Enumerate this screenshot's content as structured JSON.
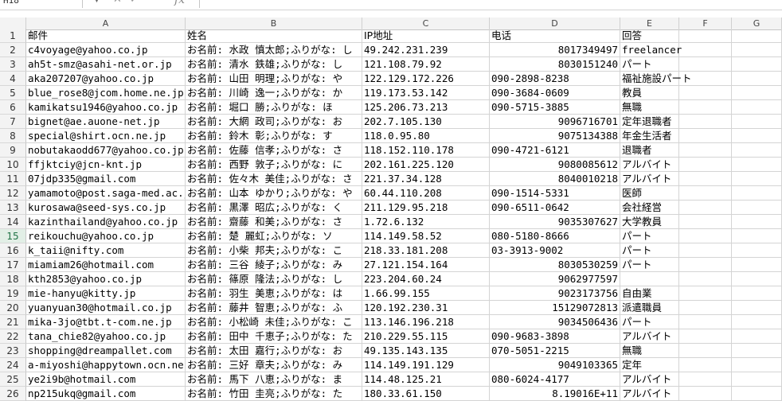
{
  "formula_bar": {
    "name_box": "H18",
    "fx_label": "fx"
  },
  "columns": [
    "A",
    "B",
    "C",
    "D",
    "E",
    "F",
    "G"
  ],
  "rows": [
    {
      "n": "1",
      "a": "邮件",
      "b": "姓名",
      "c": "IP地址",
      "d": "电话",
      "dr": false,
      "e": "回答"
    },
    {
      "n": "2",
      "a": "c4voyage@yahoo.co.jp",
      "b": "お名前: 水政 慎太郎;ふりがな: し",
      "c": "49.242.231.239",
      "d": "8017349497",
      "dr": true,
      "e": "freelancer"
    },
    {
      "n": "3",
      "a": "ah5t-smz@asahi-net.or.jp",
      "b": "お名前: 清水 鉄雄;ふりがな: し",
      "c": "121.108.79.92",
      "d": "8030151240",
      "dr": true,
      "e": "パート"
    },
    {
      "n": "4",
      "a": "aka207207@yahoo.co.jp",
      "b": "お名前: 山田 明理;ふりがな: や",
      "c": "122.129.172.226",
      "d": "090-2898-8238",
      "dr": false,
      "e": "福祉施設パート"
    },
    {
      "n": "5",
      "a": "blue_rose8@jcom.home.ne.jp",
      "b": "お名前: 川崎 逸一;ふりがな: か",
      "c": "119.173.53.142",
      "d": "090-3684-0609",
      "dr": false,
      "e": "教員"
    },
    {
      "n": "6",
      "a": "kamikatsu1946@yahoo.co.jp",
      "b": "お名前: 堀口 勝;ふりがな: ほ",
      "c": "125.206.73.213",
      "d": "090-5715-3885",
      "dr": false,
      "e": "無職"
    },
    {
      "n": "7",
      "a": "bignet@ae.auone-net.jp",
      "b": "お名前: 大網 政司;ふりがな: お",
      "c": "202.7.105.130",
      "d": "9096716701",
      "dr": true,
      "e": "定年退職者"
    },
    {
      "n": "8",
      "a": "special@shirt.ocn.ne.jp",
      "b": "お名前: 鈴木 彰;ふりがな: す",
      "c": "118.0.95.80",
      "d": "9075134388",
      "dr": true,
      "e": "年金生活者"
    },
    {
      "n": "9",
      "a": "nobutakaodd677@yahoo.co.jp",
      "b": "お名前: 佐藤 信孝;ふりがな: さ",
      "c": "118.152.110.178",
      "d": "090-4721-6121",
      "dr": false,
      "e": "退職者"
    },
    {
      "n": "10",
      "a": "ffjktciy@jcn-knt.jp",
      "b": "お名前: 西野 敦子;ふりがな: に",
      "c": "202.161.225.120",
      "d": "9080085612",
      "dr": true,
      "e": "アルバイト"
    },
    {
      "n": "11",
      "a": "07jdp335@gmail.com",
      "b": "お名前: 佐々木 美佳;ふりがな: さ",
      "c": "221.37.34.128",
      "d": "8040010218",
      "dr": true,
      "e": "アルバイト"
    },
    {
      "n": "12",
      "a": "yamamoto@post.saga-med.ac.jp",
      "b": "お名前: 山本 ゆかり;ふりがな: や",
      "c": "60.44.110.208",
      "d": "090-1514-5331",
      "dr": false,
      "e": "医師"
    },
    {
      "n": "13",
      "a": "kurosawa@seed-sys.co.jp",
      "b": "お名前: 黒澤 昭広;ふりがな: く",
      "c": "211.129.95.218",
      "d": "090-6511-0642",
      "dr": false,
      "e": "会社経営"
    },
    {
      "n": "14",
      "a": "kazinthailand@yahoo.co.jp",
      "b": "お名前: 齋藤 和美;ふりがな: さ",
      "c": "1.72.6.132",
      "d": "9035307627",
      "dr": true,
      "e": "大学教員"
    },
    {
      "n": "15",
      "a": "reikouchu@yahoo.co.jp",
      "b": "お名前: 楚 麗虹;ふりがな: ソ",
      "c": "114.149.58.52",
      "d": "080-5180-8666",
      "dr": false,
      "e": "パート"
    },
    {
      "n": "16",
      "a": "k_taii@nifty.com",
      "b": "お名前: 小柴 邦夫;ふりがな: こ",
      "c": "218.33.181.208",
      "d": "03-3913-9002",
      "dr": false,
      "e": "パート"
    },
    {
      "n": "17",
      "a": "miamiam26@hotmail.com",
      "b": "お名前: 三谷 綾子;ふりがな: み",
      "c": "27.121.154.164",
      "d": "8030530259",
      "dr": true,
      "e": "パート"
    },
    {
      "n": "18",
      "a": "kth2853@yahoo.co.jp",
      "b": "お名前: 篠原 隆法;ふりがな: し",
      "c": "223.204.60.24",
      "d": "9062977597",
      "dr": true,
      "e": ""
    },
    {
      "n": "19",
      "a": "mie-hanyu@kitty.jp",
      "b": "お名前: 羽生 美恵;ふりがな: は",
      "c": "1.66.99.155",
      "d": "9023173756",
      "dr": true,
      "e": "自由業"
    },
    {
      "n": "20",
      "a": "yuanyuan30@hotmail.co.jp",
      "b": "お名前: 藤井 智恵;ふりがな: ふ",
      "c": "120.192.230.31",
      "d": "15129072813",
      "dr": true,
      "e": "派遣職員"
    },
    {
      "n": "21",
      "a": "mika-3jo@tbt.t-com.ne.jp",
      "b": "お名前: 小松崎 未佳;ふりがな: こ",
      "c": "113.146.196.218",
      "d": "9034506436",
      "dr": true,
      "e": "パート"
    },
    {
      "n": "22",
      "a": "tana_chie82@yahoo.co.jp",
      "b": "お名前: 田中 千恵子;ふりがな: た",
      "c": "210.229.55.115",
      "d": "090-9683-3898",
      "dr": false,
      "e": "アルバイト"
    },
    {
      "n": "23",
      "a": "shopping@dreampallet.com",
      "b": "お名前: 太田 嘉行;ふりがな: お",
      "c": "49.135.143.135",
      "d": "070-5051-2215",
      "dr": false,
      "e": "無職"
    },
    {
      "n": "24",
      "a": "a-miyoshi@happytown.ocn.ne.jp",
      "b": "お名前: 三好 章夫;ふりがな: み",
      "c": "114.149.191.129",
      "d": "9049103365",
      "dr": true,
      "e": "定年"
    },
    {
      "n": "25",
      "a": "ye2i9b@hotmail.com",
      "b": "お名前: 馬下 八恵;ふりがな: ま",
      "c": "114.48.125.21",
      "d": "080-6024-4177",
      "dr": false,
      "e": "アルバイト"
    },
    {
      "n": "26",
      "a": "np215ukq@gmail.com",
      "b": "お名前: 竹田 圭亮;ふりがな: た",
      "c": "180.33.61.150",
      "d": "8.19016E+11",
      "dr": true,
      "e": "アルバイト"
    }
  ],
  "selected_row": "15"
}
